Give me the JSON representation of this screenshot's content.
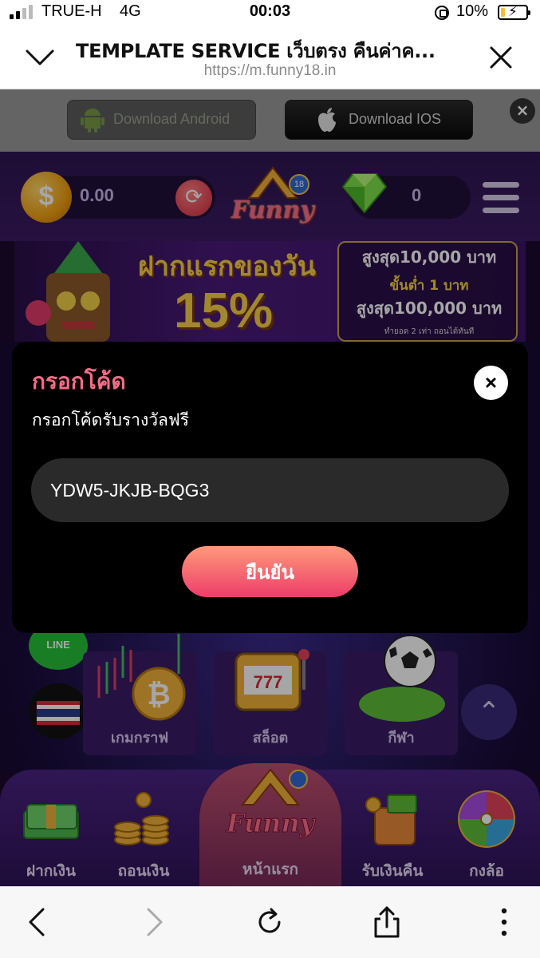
{
  "status_bar": {
    "carrier": "TRUE-H",
    "network": "4G",
    "time": "00:03",
    "battery_percent": "10%"
  },
  "browser": {
    "page_title": "TEMPLATE SERVICE เว็บตรง คืนค่าค...",
    "url": "https://m.funny18.in"
  },
  "download_bar": {
    "android_label": "Download Android",
    "ios_label": "Download IOS",
    "close_label": "×"
  },
  "site_header": {
    "balance": "0.00",
    "coin_symbol": "$",
    "gem_count": "0",
    "logo_text": "Funny",
    "logo_badge": "18"
  },
  "banner": {
    "headline": "ฝากแรกของวัน",
    "percent": "15%",
    "line1": "สูงสุด10,000 บาท",
    "line2": "ขั้นต่ำ 1 บาท",
    "line3": "สูงสุด100,000 บาท",
    "line4": "ทำยอด 2 เท่า ถอนได้ทันที"
  },
  "side_buttons": {
    "line_label": "LINE"
  },
  "categories": [
    {
      "label": "เกมกราฟ"
    },
    {
      "label": "สล็อต"
    },
    {
      "label": "กีฬา"
    }
  ],
  "bottom_nav": {
    "deposit": "ฝากเงิน",
    "withdraw": "ถอนเงิน",
    "home": "หน้าแรก",
    "cashback": "รับเงินคืน",
    "wheel": "กงล้อ"
  },
  "modal": {
    "title": "กรอกโค้ด",
    "subtitle": "กรอกโค้ดรับรางวัลฟรี",
    "code_value": "YDW5-JKJB-BQG3",
    "confirm_label": "ยืนยัน",
    "close_label": "×"
  },
  "colors": {
    "modal_title": "#f46d85",
    "confirm_gradient_top": "#ff9a7a",
    "confirm_gradient_bottom": "#ee3d6b",
    "site_header": "#2e1552"
  },
  "icons": {
    "browser_collapse": "chevron-down-icon",
    "browser_close": "close-icon",
    "toolbar": [
      "back-icon",
      "forward-icon",
      "reload-icon",
      "share-icon",
      "more-icon"
    ]
  }
}
